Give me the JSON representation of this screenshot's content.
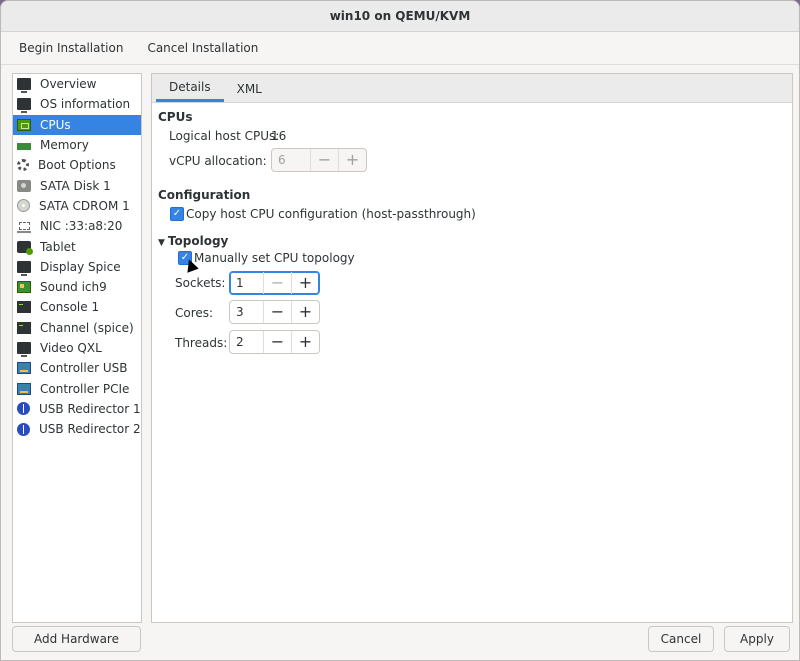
{
  "window": {
    "title": "win10 on QEMU/KVM"
  },
  "toolbar": {
    "begin": "Begin Installation",
    "cancel": "Cancel Installation"
  },
  "sidebar": {
    "items": [
      {
        "label": "Overview",
        "icon": "monitor-icon"
      },
      {
        "label": "OS information",
        "icon": "monitor-icon"
      },
      {
        "label": "CPUs",
        "icon": "cpu-chip-icon",
        "selected": true
      },
      {
        "label": "Memory",
        "icon": "memory-icon"
      },
      {
        "label": "Boot Options",
        "icon": "gear-icon"
      },
      {
        "label": "SATA Disk 1",
        "icon": "disk-icon"
      },
      {
        "label": "SATA CDROM 1",
        "icon": "cdrom-icon"
      },
      {
        "label": "NIC :33:a8:20",
        "icon": "network-icon"
      },
      {
        "label": "Tablet",
        "icon": "tablet-icon"
      },
      {
        "label": "Display Spice",
        "icon": "monitor-icon"
      },
      {
        "label": "Sound ich9",
        "icon": "sound-card-icon"
      },
      {
        "label": "Console 1",
        "icon": "terminal-icon"
      },
      {
        "label": "Channel (spice)",
        "icon": "terminal-icon"
      },
      {
        "label": "Video QXL",
        "icon": "monitor-icon"
      },
      {
        "label": "Controller USB",
        "icon": "pci-card-icon"
      },
      {
        "label": "Controller PCIe",
        "icon": "pci-card-icon"
      },
      {
        "label": "USB Redirector 1",
        "icon": "usb-icon"
      },
      {
        "label": "USB Redirector 2",
        "icon": "usb-icon"
      }
    ]
  },
  "tabs": {
    "details": "Details",
    "xml": "XML"
  },
  "cpus": {
    "section": "CPUs",
    "logical_label": "Logical host CPUs:",
    "logical_value": "16",
    "vcpu_label": "vCPU allocation:",
    "vcpu_value": "6"
  },
  "config": {
    "section": "Configuration",
    "copy_host": "Copy host CPU configuration (host-passthrough)",
    "copy_host_checked": true
  },
  "topology": {
    "section": "Topology",
    "manual": "Manually set CPU topology",
    "manual_checked": true,
    "sockets_label": "Sockets:",
    "sockets_value": "1",
    "cores_label": "Cores:",
    "cores_value": "3",
    "threads_label": "Threads:",
    "threads_value": "2"
  },
  "footer": {
    "add_hardware": "Add Hardware",
    "cancel": "Cancel",
    "apply": "Apply"
  },
  "colors": {
    "accent": "#3584e4"
  }
}
